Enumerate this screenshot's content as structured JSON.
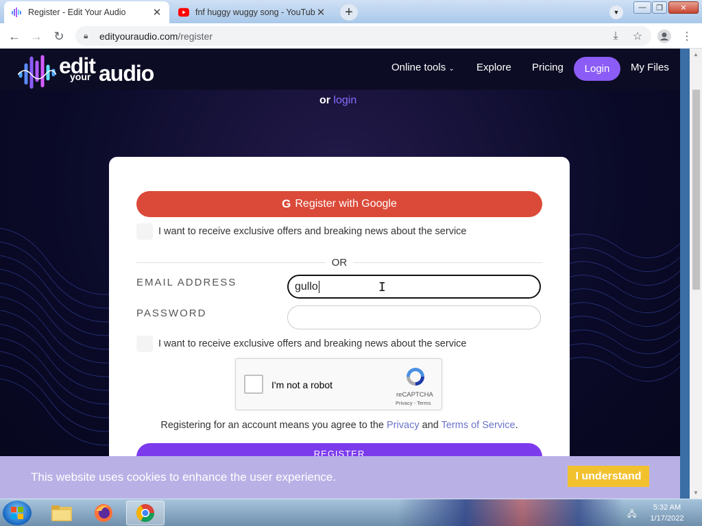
{
  "browser": {
    "tabs": [
      {
        "title": "Register - Edit Your Audio",
        "active": true
      },
      {
        "title": "fnf huggy wuggy song - YouTube",
        "active": false
      }
    ],
    "url_domain": "edityouraudio.com",
    "url_path": "/register"
  },
  "site": {
    "logo_line1": "edit",
    "logo_line2": "your",
    "logo_line3": "audio",
    "nav": {
      "online_tools": "Online tools",
      "explore": "Explore",
      "pricing": "Pricing",
      "login": "Login",
      "my_files": "My Files"
    },
    "or_text": "or",
    "login_link": "login"
  },
  "form": {
    "google_button": "Register with Google",
    "google_letter": "G",
    "newsletter_label": "I want to receive exclusive offers and breaking news about the service",
    "or_divider": "OR",
    "email_label": "EMAIL ADDRESS",
    "email_value": "gullo",
    "password_label": "PASSWORD",
    "password_value": "",
    "captcha_text": "I'm not a robot",
    "captcha_brand": "reCAPTCHA",
    "captcha_links": "Privacy - Terms",
    "terms_prefix": "Registering for an account means you agree to the",
    "terms_privacy": "Privacy",
    "terms_and": "and",
    "terms_tos": "Terms of Service",
    "terms_suffix": ".",
    "register_button": "REGISTER"
  },
  "cookie": {
    "message": "This website uses cookies to enhance the user experience.",
    "button": "I understand"
  },
  "taskbar": {
    "time": "5:32 AM",
    "date": "1/17/2022"
  },
  "colors": {
    "accent_purple": "#8b5cf6",
    "google_red": "#db4a39",
    "cookie_bg": "#b9b1e6",
    "cookie_button": "#f2c12e"
  }
}
